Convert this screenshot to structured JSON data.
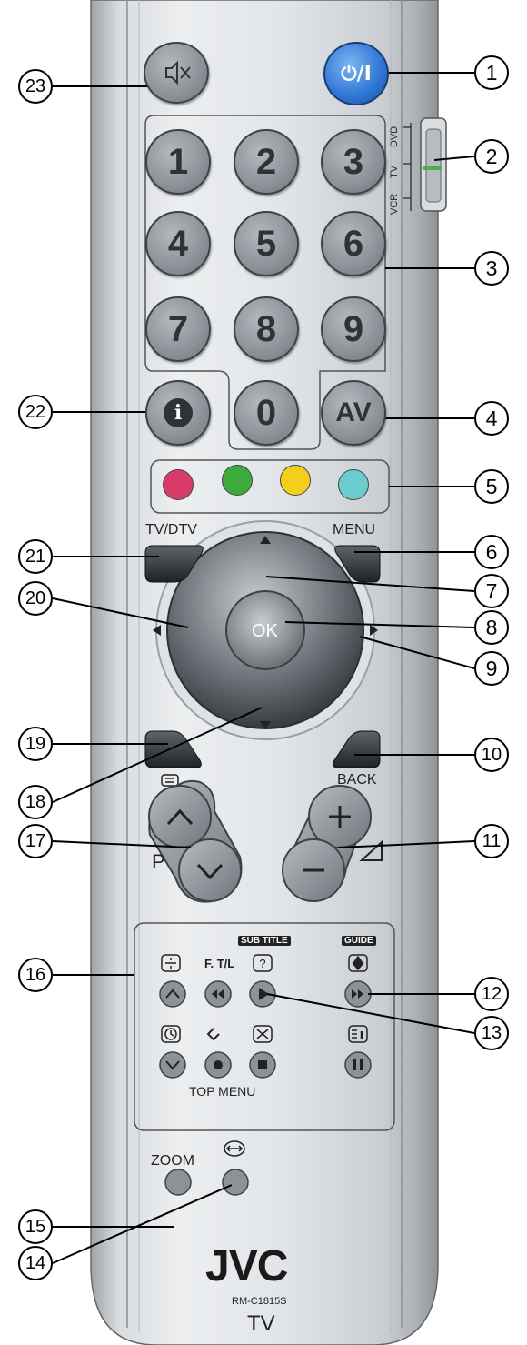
{
  "figure": {
    "brand": "JVC",
    "model": "RM-C1815S",
    "device": "TV"
  },
  "buttons": {
    "power": "⏻/I",
    "digits": [
      "1",
      "2",
      "3",
      "4",
      "5",
      "6",
      "7",
      "8",
      "9"
    ],
    "zero": "0",
    "av": "AV",
    "ok": "OK"
  },
  "switch_labels": [
    "DVD",
    "TV",
    "VCR"
  ],
  "labels": {
    "tv_dtv": "TV/DTV",
    "menu": "MENU",
    "back": "BACK",
    "p": "P",
    "f_tl": "F. T/L",
    "sub_title": "SUB TITLE",
    "guide": "GUIDE",
    "top_menu": "TOP MENU",
    "zoom": "ZOOM"
  },
  "color_keys": {
    "red": "#d83a6a",
    "green": "#3cab3c",
    "yellow": "#f2cf1a",
    "cyan": "#6ccdd0"
  },
  "icons": [
    "mute-icon",
    "power-icon",
    "info-icon",
    "teletext-icon",
    "volume-triangle-icon",
    "page-split-icon",
    "help-icon",
    "guide-icon",
    "clock-icon",
    "top-menu-icon",
    "cancel-icon",
    "list-info-icon",
    "aspect-icon",
    "rewind-icon",
    "play-icon",
    "fast-forward-icon",
    "record-icon",
    "stop-icon",
    "pause-icon"
  ],
  "callouts": [
    "1",
    "2",
    "3",
    "4",
    "5",
    "6",
    "7",
    "8",
    "9",
    "10",
    "11",
    "12",
    "13",
    "14",
    "15",
    "16",
    "17",
    "18",
    "19",
    "20",
    "21",
    "22",
    "23"
  ]
}
